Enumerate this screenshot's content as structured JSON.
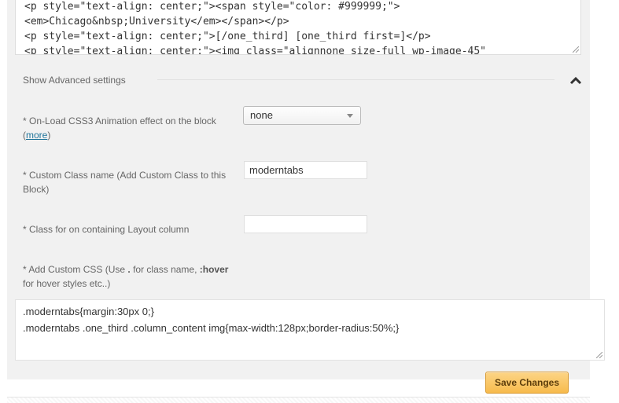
{
  "editor": {
    "lines": [
      "<p style=\"text-align: center;\"><span style=\"color: #999999;\">",
      "<em>Chicago&nbsp;University</em></span></p>",
      "<p style=\"text-align: center;\">[/one_third] [one_third first=]</p>",
      "<p style=\"text-align: center;\"><img class=\"alignnone size-full wp-image-45\""
    ]
  },
  "advanced": {
    "title": "Show Advanced settings",
    "toggle_icon": "chevron-up-icon"
  },
  "animation": {
    "label": "* On-Load CSS3 Animation effect on the block",
    "more_open": "(",
    "more_link": "more",
    "more_close": ")",
    "selected": "none"
  },
  "custom_class": {
    "label": "* Custom Class name (Add Custom Class to this Block)",
    "value": "moderntabs"
  },
  "layout_class": {
    "label": "* Class for on containing Layout column",
    "value": ""
  },
  "custom_css": {
    "label_pre": "* Add Custom CSS (Use ",
    "label_dot": ".",
    "label_mid": " for class name, ",
    "label_hover": ":hover",
    "label_post": " for hover styles etc..)",
    "lines": [
      ".moderntabs{margin:30px 0;}",
      ".moderntabs .one_third .column_content img{max-width:128px;border-radius:50%;}"
    ]
  },
  "save_button": "Save Changes",
  "colors": {
    "panel_bg": "#f1f1f1",
    "link": "#21759b",
    "button_bg": "#f7bb4c"
  }
}
